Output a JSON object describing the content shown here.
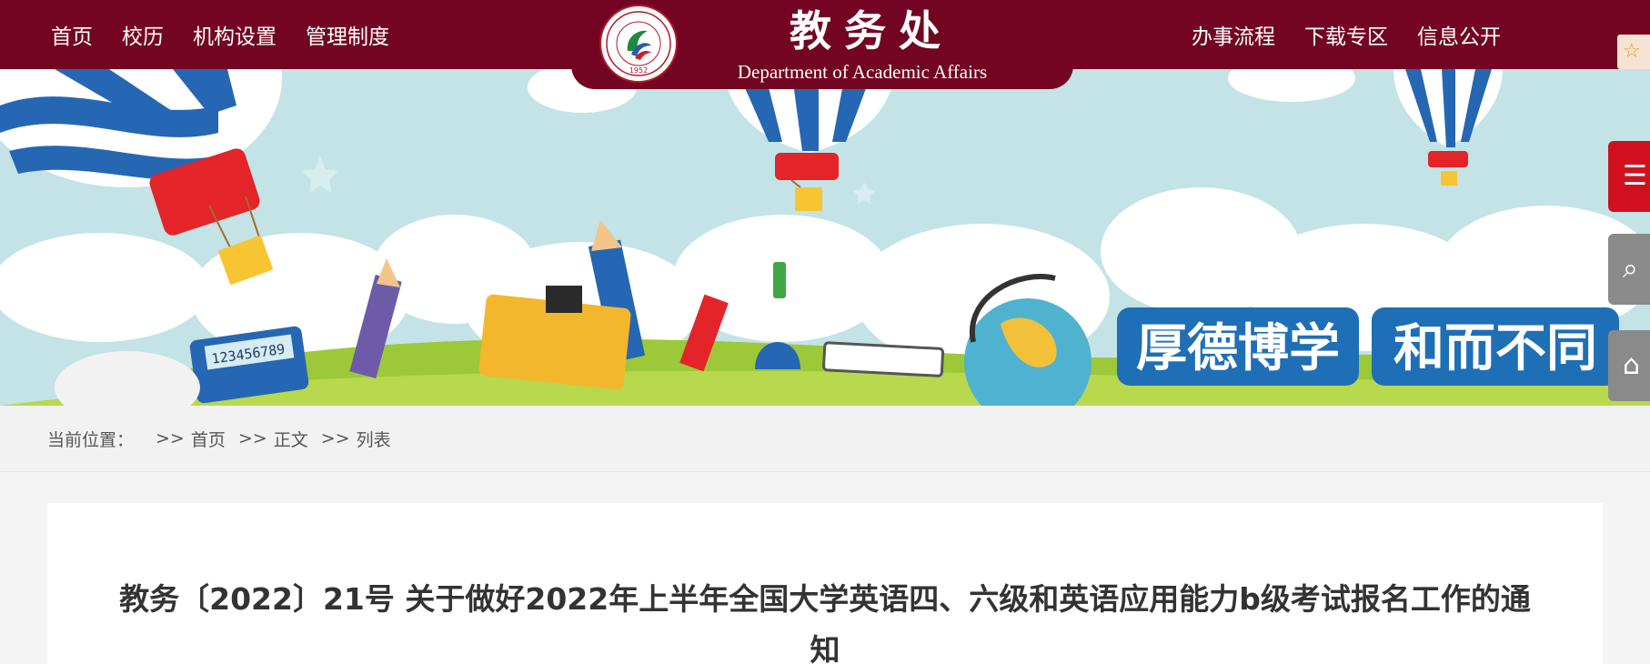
{
  "header": {
    "nav_left": [
      "首页",
      "校历",
      "机构设置",
      "管理制度"
    ],
    "nav_right": [
      "办事流程",
      "下载专区",
      "信息公开"
    ],
    "brand_title": "教务处",
    "brand_subtitle": "Department of Academic Affairs",
    "logo_year": "1952",
    "logo_icon": "university-seal-icon",
    "favorite_icon": "star-icon",
    "favorite_glyph": "☆"
  },
  "banner": {
    "motto_left": "厚德博学",
    "motto_right": "和而不同",
    "calculator_text": "123456789",
    "colors": {
      "sky": "#c3e3e6",
      "grass": "#9cc83a",
      "motto_bg": "#1f6fb6"
    }
  },
  "side_buttons": {
    "menu_icon": "list-icon",
    "menu_glyph": "☰",
    "search_icon": "search-icon",
    "search_glyph": "⌕",
    "home_icon": "home-icon",
    "home_glyph": "⌂"
  },
  "breadcrumb": {
    "label": "当前位置：",
    "separator": ">>",
    "items": [
      "首页",
      "正文",
      "列表"
    ]
  },
  "article": {
    "title": "教务〔2022〕21号 关于做好2022年上半年全国大学英语四、六级和英语应用能力b级考试报名工作的通知"
  },
  "colors": {
    "brand": "#730522",
    "side_active": "#d0101e",
    "side_inactive": "#8a8a8a"
  }
}
